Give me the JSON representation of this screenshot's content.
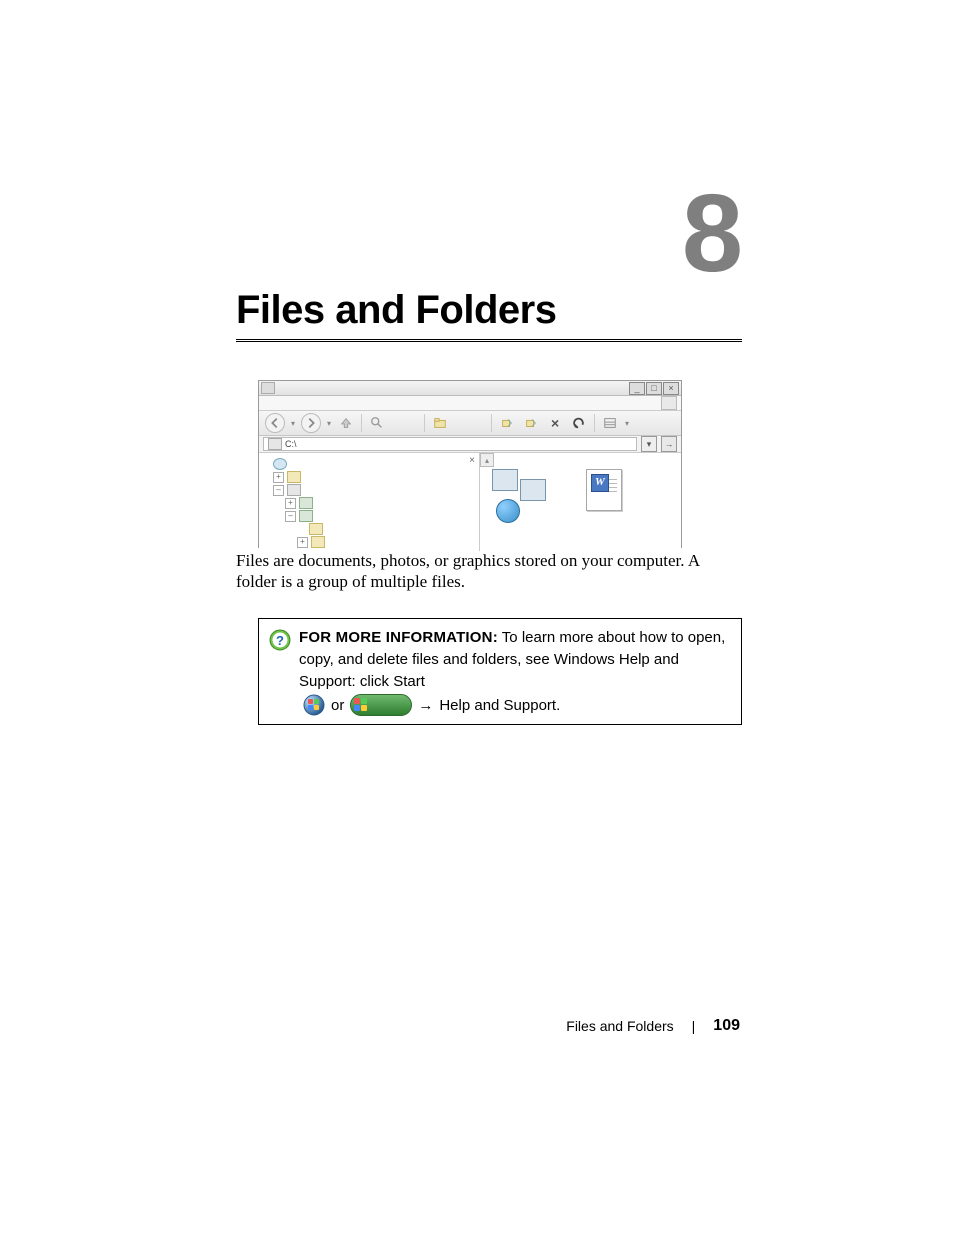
{
  "chapter_number": "8",
  "chapter_title": "Files and Folders",
  "screenshot": {
    "address": "C:\\",
    "tree_close": "×",
    "win_min": "_",
    "win_max": "□",
    "win_close": "×",
    "scroll_up": "▴",
    "dd": "▾",
    "go": "→",
    "plus": "+",
    "minus": "–"
  },
  "paragraph": "Files are documents, photos, or graphics stored on your computer. A folder is a group of multiple files.",
  "info": {
    "lead": "FOR MORE INFORMATION:",
    "line1": " To learn more about how to open, copy, and delete files and folders, see Windows Help and Support: click Start",
    "or": " or ",
    "arrow": "→",
    "help": " Help and Support."
  },
  "footer": {
    "section": "Files and Folders",
    "page": "109"
  }
}
